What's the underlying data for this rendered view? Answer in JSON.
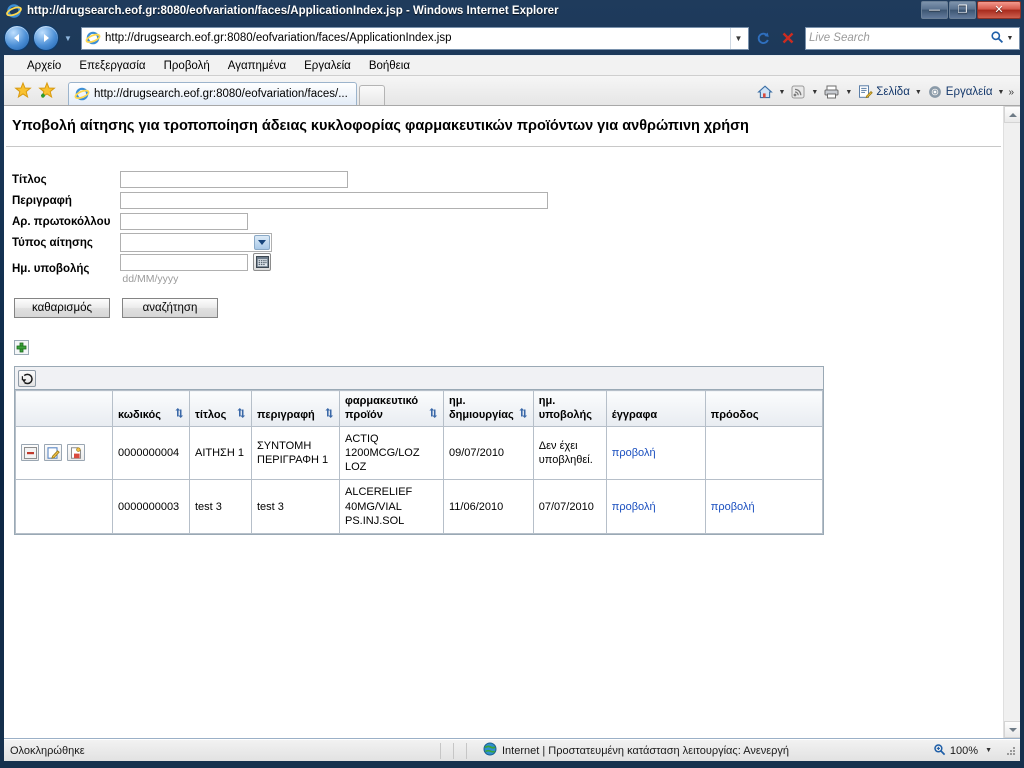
{
  "window": {
    "title": "http://drugsearch.eof.gr:8080/eofvariation/faces/ApplicationIndex.jsp - Windows Internet Explorer",
    "minimize_label": "—",
    "maximize_label": "❐",
    "close_label": "✕"
  },
  "navigation": {
    "back_label": "◀",
    "forward_label": "▶",
    "recent_chevron": "▼",
    "url": "http://drugsearch.eof.gr:8080/eofvariation/faces/ApplicationIndex.jsp",
    "url_dropdown_label": "▼",
    "refresh_label": "refresh-icon",
    "stop_label": "✕",
    "search_placeholder": "Live Search",
    "search_go_label": "search-icon",
    "search_dropdown_label": "▼"
  },
  "menubar": {
    "items": [
      {
        "label": "Αρχείο"
      },
      {
        "label": "Επεξεργασία"
      },
      {
        "label": "Προβολή"
      },
      {
        "label": "Αγαπημένα"
      },
      {
        "label": "Εργαλεία"
      },
      {
        "label": "Βοήθεια"
      }
    ]
  },
  "commandbar": {
    "favorites_center_label": "favorites-star-icon",
    "add_favorite_label": "add-favorite-icon",
    "tab": {
      "label": "http://drugsearch.eof.gr:8080/eofvariation/faces/..."
    },
    "new_tab_label": "",
    "right_items": [
      {
        "name": "home",
        "label": ""
      },
      {
        "name": "feeds",
        "label": ""
      },
      {
        "name": "print",
        "label": ""
      },
      {
        "name": "page",
        "label": "Σελίδα"
      },
      {
        "name": "tools",
        "label": "Εργαλεία"
      }
    ],
    "overflow_label": "»",
    "caret": "▼"
  },
  "page": {
    "title": "Υποβολή αίτησης για τροποποίηση άδειας κυκλοφορίας φαρμακευτικών προϊόντων για ανθρώπινη χρήση",
    "form": {
      "fields": [
        {
          "name": "title",
          "label": "Τίτλος",
          "value": "",
          "placeholder": ""
        },
        {
          "name": "description",
          "label": "Περιγραφή",
          "value": "",
          "placeholder": ""
        },
        {
          "name": "protocol-number",
          "label": "Αρ. πρωτοκόλλου",
          "value": "",
          "placeholder": ""
        },
        {
          "name": "application-type",
          "label": "Τύπος αίτησης",
          "value": "",
          "placeholder": ""
        },
        {
          "name": "submission-date",
          "label": "Ημ. υποβολής",
          "value": "",
          "placeholder": "",
          "hint": "dd/MM/yyyy"
        }
      ],
      "application_type_options": [
        ""
      ],
      "buttons": {
        "clear": "καθαρισμός",
        "search": "αναζήτηση"
      },
      "calendar_button_label": "calendar-icon"
    },
    "add_button_label": "+",
    "grid_toolbar": {
      "refresh_label": "refresh-sort-icon"
    },
    "grid": {
      "columns": [
        {
          "label": "",
          "sortable": false
        },
        {
          "label": "κωδικός",
          "sortable": true
        },
        {
          "label": "τίτλος",
          "sortable": true
        },
        {
          "label": "περιγραφή",
          "sortable": true
        },
        {
          "label": "φαρμακευτικό προϊόν",
          "sortable": true
        },
        {
          "label": "ημ. δημιουργίας",
          "sortable": true
        },
        {
          "label": "ημ. υποβολής",
          "sortable": false
        },
        {
          "label": "έγγραφα",
          "sortable": false
        },
        {
          "label": "πρόοδος",
          "sortable": false
        }
      ],
      "rows": [
        {
          "has_actions": true,
          "actions": [
            {
              "name": "delete-row-button",
              "label": "delete-icon"
            },
            {
              "name": "edit-row-button",
              "label": "edit-icon"
            },
            {
              "name": "document-row-button",
              "label": "document-icon"
            }
          ],
          "code": "0000000004",
          "title": "ΑΙΤΗΣΗ 1",
          "description": "ΣΥΝΤΟΜΗ ΠΕΡΙΓΡΑΦΗ 1",
          "product": "ACTIQ 1200MCG/LOZ LOZ",
          "created": "09/07/2010",
          "submitted": "Δεν έχει υποβληθεί.",
          "documents": "προβολή",
          "progress": ""
        },
        {
          "has_actions": false,
          "actions": [],
          "code": "0000000003",
          "title": "test 3",
          "description": "test 3",
          "product": "ALCERELIEF 40MG/VIAL PS.INJ.SOL",
          "created": "11/06/2010",
          "submitted": "07/07/2010",
          "documents": "προβολή",
          "progress": "προβολή"
        }
      ]
    }
  },
  "statusbar": {
    "status": "Ολοκληρώθηκε",
    "zone": "Internet | Προστατευμένη κατάσταση λειτουργίας: Ανενεργή",
    "zoom": "100%",
    "zoom_caret": "▼"
  }
}
